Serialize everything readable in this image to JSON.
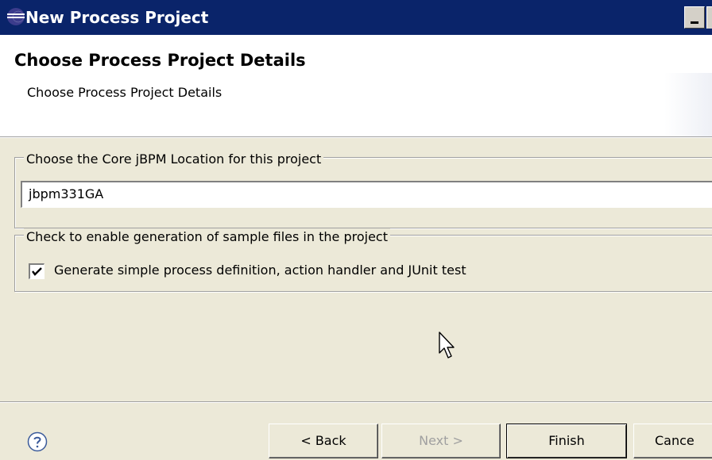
{
  "window": {
    "title": "New Process Project",
    "icon": "eclipse-icon"
  },
  "banner": {
    "heading": "Choose Process Project Details",
    "subheading": "Choose Process Project Details"
  },
  "location_group": {
    "legend": "Choose the Core jBPM Location for this project",
    "field_value": "jbpm331GA"
  },
  "sample_group": {
    "legend": "Check to enable generation of sample files in the project",
    "checkbox_label": "Generate simple process definition, action handler and JUnit test",
    "checked": true
  },
  "footer": {
    "help_icon": "help-icon",
    "back_label": "< Back",
    "next_label": "Next >",
    "finish_label": "Finish",
    "cancel_label": "Cance"
  },
  "colors": {
    "titlebar": "#0a246a",
    "dialog_bg": "#ece9d8",
    "disabled_text": "#a0a0a0"
  }
}
